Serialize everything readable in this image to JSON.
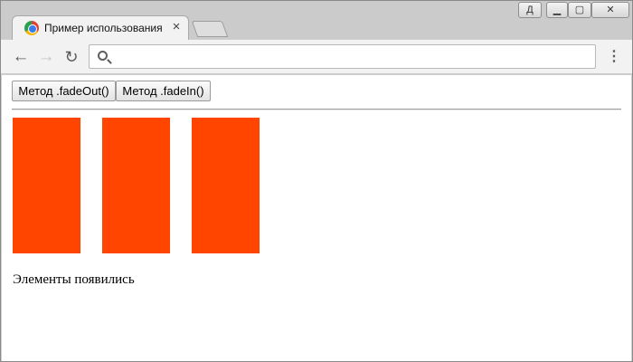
{
  "browser": {
    "tab": {
      "title": "Пример использования jQuery",
      "close_glyph": "×",
      "favicon": "chrome-icon"
    },
    "window_controls": {
      "profile_label": "Д",
      "minimize_glyph": "▁",
      "maximize_glyph": "▢",
      "close_glyph": "✕"
    },
    "toolbar": {
      "back_glyph": "←",
      "forward_glyph": "→",
      "reload_glyph": "↻",
      "menu_glyph": "⋮",
      "address_value": ""
    }
  },
  "page": {
    "buttons": {
      "fadeout_label": "Метод .fadeOut()",
      "fadein_label": "Метод .fadeIn()"
    },
    "box_color": "#ff4500",
    "box_count": 3,
    "status_text": "Элементы появились"
  }
}
